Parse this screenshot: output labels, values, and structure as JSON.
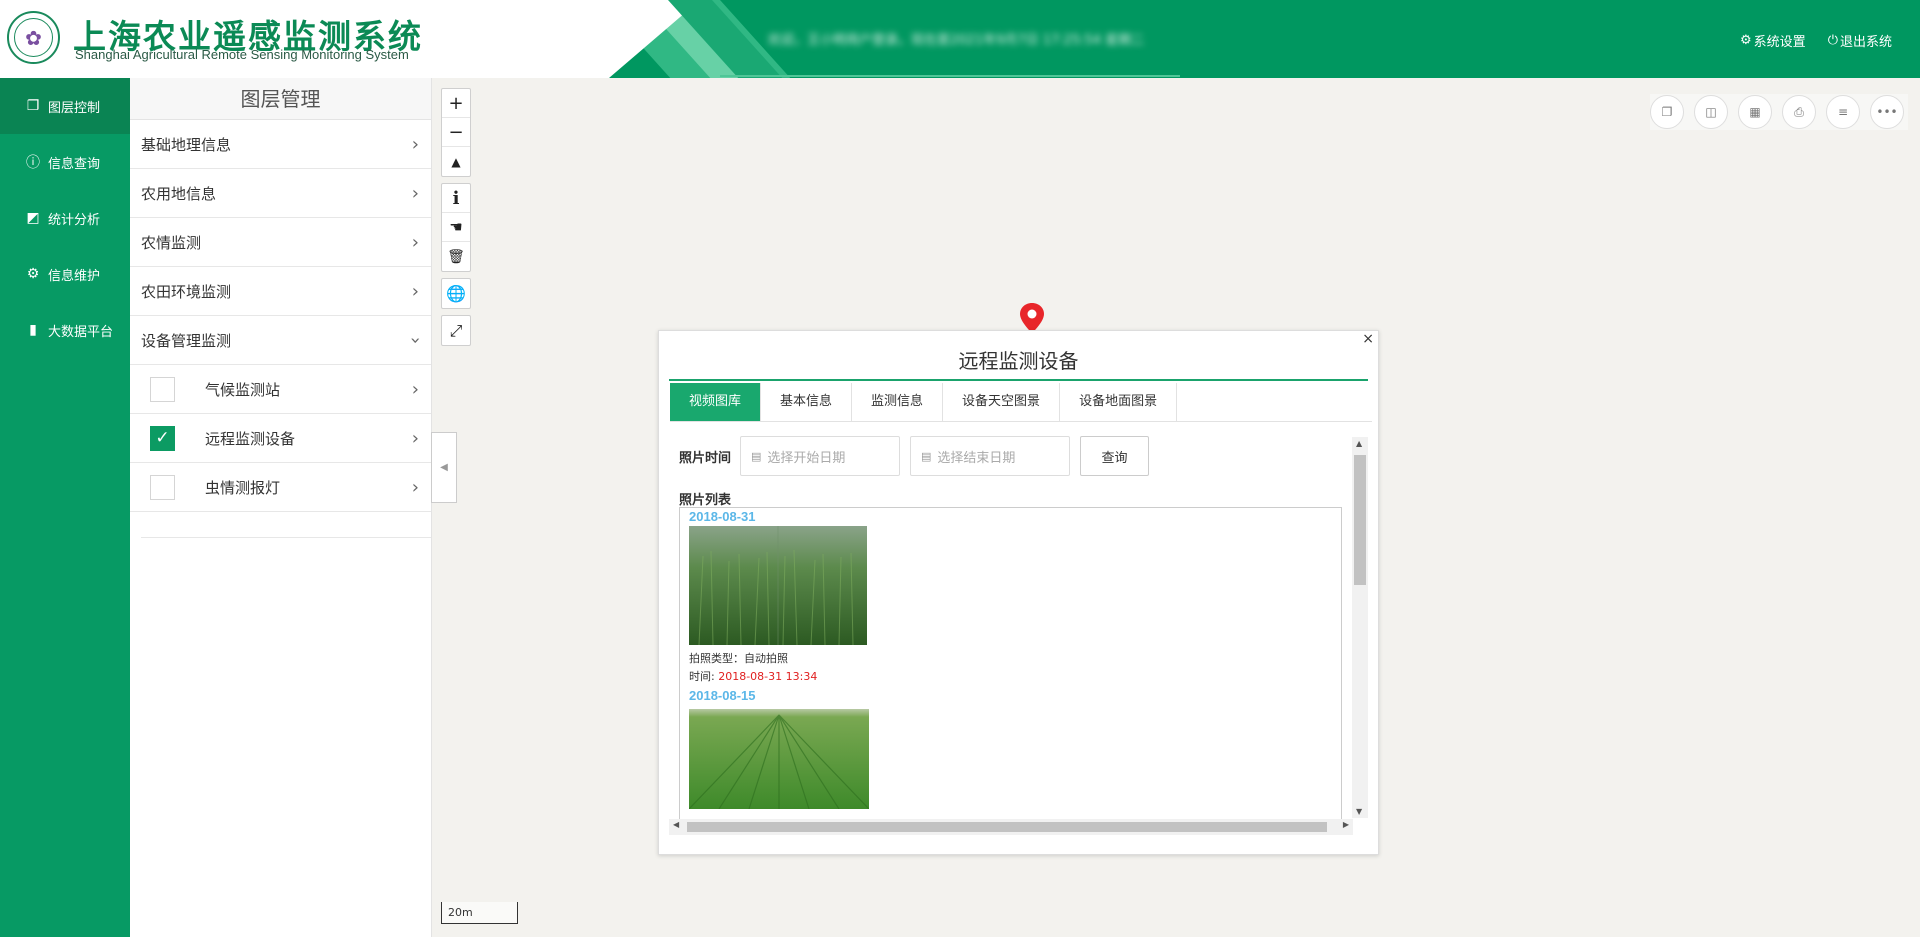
{
  "header": {
    "title_cn": "上海农业遥感监测系统",
    "title_en": "Shanghai Agricultural Remote Sensing Monitoring System",
    "marquee": "欢迎，王小明用户登录。现在是2021年9月7日 17:25:54 星期二",
    "links": {
      "settings": "系统设置",
      "logout": "退出系统"
    }
  },
  "nav": {
    "items": [
      {
        "label": "图层控制",
        "icon": "layers-icon"
      },
      {
        "label": "信息查询",
        "icon": "info-icon"
      },
      {
        "label": "统计分析",
        "icon": "chart-icon"
      },
      {
        "label": "信息维护",
        "icon": "gear-icon"
      },
      {
        "label": "大数据平台",
        "icon": "bar-chart-icon"
      }
    ]
  },
  "layers": {
    "title": "图层管理",
    "groups": [
      {
        "label": "基础地理信息"
      },
      {
        "label": "农用地信息"
      },
      {
        "label": "农情监测"
      },
      {
        "label": "农田环境监测"
      },
      {
        "label": "设备管理监测"
      }
    ],
    "sub": [
      {
        "label": "气候监测站",
        "checked": false
      },
      {
        "label": "远程监测设备",
        "checked": true
      },
      {
        "label": "虫情测报灯",
        "checked": false
      }
    ]
  },
  "map": {
    "scale": "20m"
  },
  "popup": {
    "title": "远程监测设备",
    "close": "×",
    "tabs": [
      "视频图库",
      "基本信息",
      "监测信息",
      "设备天空图景",
      "设备地面图景"
    ],
    "filter_label": "照片时间",
    "start_placeholder": "选择开始日期",
    "end_placeholder": "选择结束日期",
    "query": "查询",
    "list_label": "照片列表",
    "entries": [
      {
        "date": "2018-08-31",
        "type_label": "拍照类型：",
        "type": "自动拍照",
        "time_label": "时间: ",
        "time": "2018-08-31 13:34"
      },
      {
        "date": "2018-08-15"
      }
    ]
  },
  "colors": {
    "primary": "#009760",
    "nav_bg": "#079a64",
    "nav_active": "#0a8453",
    "tab_active": "#19a86e",
    "date_blue": "#5bb7e8",
    "time_red": "#e02020"
  }
}
